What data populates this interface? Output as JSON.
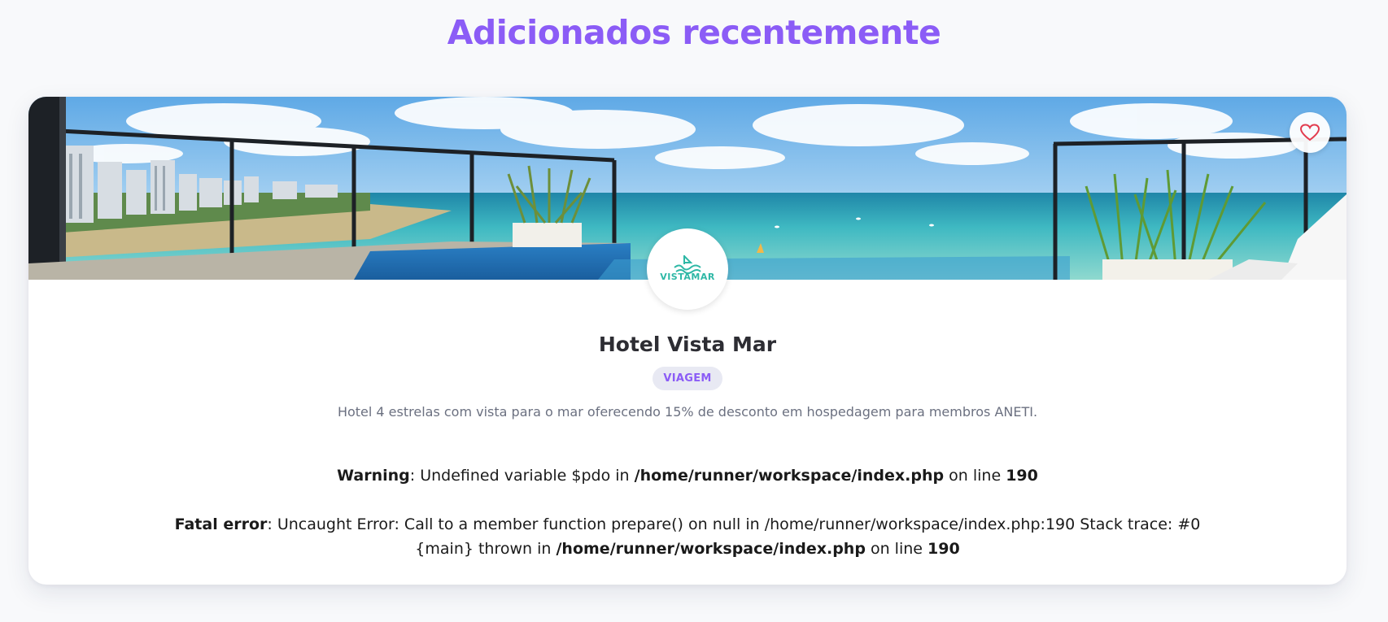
{
  "section": {
    "title": "Adicionados recentemente"
  },
  "card": {
    "hotel_name": "Hotel Vista Mar",
    "category": "VIAGEM",
    "description": "Hotel 4 estrelas com vista para o mar oferecendo 15% de desconto em hospedagem para membros ANETI.",
    "logo_text": "VISTAMAR",
    "favorite_icon": "heart-icon"
  },
  "errors": {
    "warning": {
      "label": "Warning",
      "message": ": Undefined variable $pdo in ",
      "file": "/home/runner/workspace/index.php",
      "on_line": " on line ",
      "line": "190"
    },
    "fatal": {
      "label": "Fatal error",
      "message": ": Uncaught Error: Call to a member function prepare() on null in /home/runner/workspace/index.php:190 Stack trace: #0 {main} thrown in ",
      "file": "/home/runner/workspace/index.php",
      "on_line": " on line ",
      "line": "190"
    }
  },
  "colors": {
    "accent": "#8b5cf6",
    "logo": "#2fb8a6",
    "heart": "#e23b4e"
  }
}
